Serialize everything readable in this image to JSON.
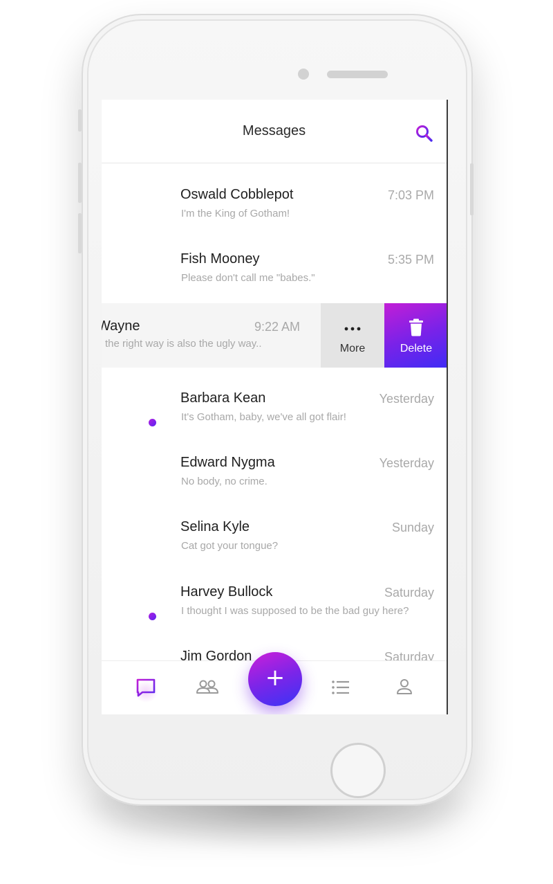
{
  "header": {
    "title": "Messages"
  },
  "conversations": [
    {
      "name": "Oswald Cobblepot",
      "preview": "I'm the King of Gotham!",
      "time": "7:03 PM",
      "unread": false
    },
    {
      "name": "Fish Mooney",
      "preview": "Please don't call me \"babes.\"",
      "time": "5:35 PM",
      "unread": false
    },
    {
      "name": "Wayne",
      "preview": "the right way is also the ugly way..",
      "time": "9:22 AM",
      "unread": false,
      "swiped": true
    },
    {
      "name": "Barbara Kean",
      "preview": "It's Gotham, baby, we've all got flair!",
      "time": "Yesterday",
      "unread": true
    },
    {
      "name": "Edward Nygma",
      "preview": "No body, no crime.",
      "time": "Yesterday",
      "unread": false
    },
    {
      "name": "Selina Kyle",
      "preview": "Cat got your tongue?",
      "time": "Sunday",
      "unread": false
    },
    {
      "name": "Harvey Bullock",
      "preview": "I thought I was supposed to be the bad guy here?",
      "time": "Saturday",
      "unread": true
    },
    {
      "name": "Jim Gordon",
      "preview": "",
      "time": "Saturday",
      "unread": false
    }
  ],
  "swipe_actions": {
    "more_label": "More",
    "delete_label": "Delete"
  },
  "fab": {
    "label": "+"
  },
  "tabs": [
    {
      "icon": "chat-icon",
      "active": true
    },
    {
      "icon": "group-icon",
      "active": false
    },
    {
      "icon": "list-icon",
      "active": false
    },
    {
      "icon": "profile-icon",
      "active": false
    }
  ],
  "colors": {
    "accent_start": "#c21ed6",
    "accent_end": "#3f2cf5",
    "unread_dot": "#8a22e8"
  }
}
